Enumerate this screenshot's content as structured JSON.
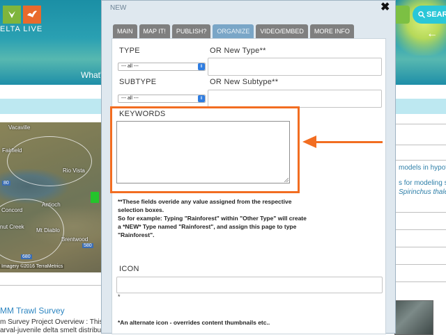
{
  "background": {
    "logo_text": "ELTA LIVE",
    "nav_text": "What'",
    "search_label": "SEAR",
    "map": {
      "labels": [
        "Vacaville",
        "Fairfield",
        "Rio Vista",
        "Antioch",
        "Concord",
        "Brentwood",
        "nut Creek",
        "Mt Diablo"
      ],
      "shields": [
        "80",
        "680",
        "580"
      ],
      "copyright": "Imagery ©2016 TerraMetrics"
    },
    "left_section_title": "MM Trawl Survey",
    "left_section_desc": [
      "m Survey Project Overview : This",
      "arval-juvenile delta smelt distributi"
    ],
    "right_texts": [
      "models in hypothe",
      "s for modeling su",
      "Spirinchus thaleic"
    ]
  },
  "modal": {
    "title": "NEW",
    "close_label": "✖",
    "tabs": [
      {
        "label": "MAIN",
        "active": false
      },
      {
        "label": "MAP IT!",
        "active": false
      },
      {
        "label": "PUBLISH?",
        "active": false
      },
      {
        "label": "ORGANIZE",
        "active": true
      },
      {
        "label": "VIDEO/EMBED",
        "active": false
      },
      {
        "label": "MORE INFO",
        "active": false
      }
    ],
    "type_label": "TYPE",
    "type_select_value": "--- all ---",
    "new_type_label": "OR New Type**",
    "new_type_value": "",
    "subtype_label": "SUBTYPE",
    "subtype_select_value": "--- all ---",
    "new_subtype_label": "OR New Subtype**",
    "new_subtype_value": "",
    "keywords_label": "KEYWORDS",
    "keywords_value": "",
    "note_lines": [
      "**These fields overide any value assigned from the respective",
      "selection boxes.",
      "So for example: Typing \"Rainforest\" within \"Other Type\" will create",
      "a *NEW* Type named \"Rainforest\", and assign this page to type",
      "\"Rainforest\"."
    ],
    "icon_label": "ICON",
    "icon_value": "",
    "icon_asterisk": "*",
    "icon_note": "*An alternate icon - overrides content thumbnails etc.."
  },
  "colors": {
    "highlight": "#f26d21",
    "active_tab": "#7aa6c7",
    "inactive_tab": "#7f7f7f",
    "header_teal": "#2aa0b2",
    "search_button": "#2ac7d8"
  }
}
